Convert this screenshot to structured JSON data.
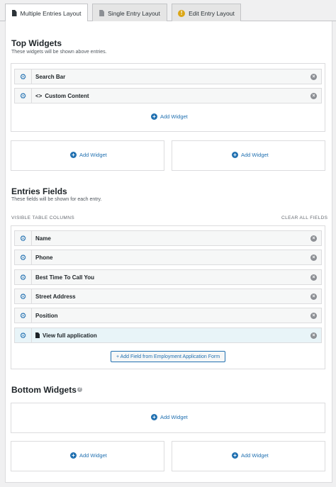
{
  "tabs": [
    {
      "label": "Multiple Entries Layout",
      "active": true
    },
    {
      "label": "Single Entry Layout",
      "active": false
    },
    {
      "label": "Edit Entry Layout",
      "active": false
    }
  ],
  "top_widgets": {
    "title": "Top Widgets",
    "description": "These widgets will be shown above entries.",
    "items": [
      {
        "label": "Search Bar"
      },
      {
        "label": "Custom Content"
      }
    ],
    "add_widget_label": "Add Widget",
    "left_add_label": "Add Widget",
    "right_add_label": "Add Widget"
  },
  "entries_fields": {
    "title": "Entries Fields",
    "description": "These fields will be shown for each entry.",
    "visible_columns_label": "VISIBLE TABLE COLUMNS",
    "clear_all_label": "CLEAR ALL FIELDS",
    "fields": [
      {
        "label": "Name"
      },
      {
        "label": "Phone"
      },
      {
        "label": "Best Time To Call You"
      },
      {
        "label": "Street Address"
      },
      {
        "label": "Position"
      },
      {
        "label": "View full application"
      }
    ],
    "add_field_label": "+ Add Field from Employment Application Form"
  },
  "bottom_widgets": {
    "title": "Bottom Widgets",
    "help_glyph": "?",
    "full_add_label": "Add Widget",
    "left_add_label": "Add Widget",
    "right_add_label": "Add Widget"
  },
  "icons": {
    "gear": "⚙",
    "close": "×",
    "plus": "+",
    "warning": "!",
    "code": "<>"
  },
  "colors": {
    "accent": "#2271b1",
    "warning": "#dba617",
    "highlight_row": "#e8f4f8"
  }
}
